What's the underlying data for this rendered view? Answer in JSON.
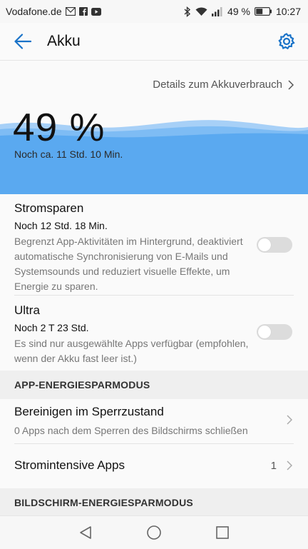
{
  "status_bar": {
    "carrier": "Vodafone.de",
    "icons_left": [
      "mail-icon",
      "facebook-icon",
      "youtube-icon"
    ],
    "icons_right": [
      "bluetooth-icon",
      "wifi-icon",
      "signal-icon",
      "battery-icon"
    ],
    "battery_percent": "49 %",
    "time": "10:27"
  },
  "header": {
    "title": "Akku"
  },
  "hero": {
    "details_link": "Details zum Akkuverbrauch",
    "percent": "49 %",
    "remaining": "Noch ca. 11 Std. 10 Min.",
    "wave_color": "#5aa9f0"
  },
  "power_saving": {
    "title": "Stromsparen",
    "subtitle": "Noch 12 Std. 18 Min.",
    "description": "Begrenzt App-Aktivitäten im Hintergrund, deaktiviert automatische Synchronisierung von E-Mails und Systemsounds und reduziert visuelle Effekte, um Energie zu sparen.",
    "enabled": false
  },
  "ultra": {
    "title": "Ultra",
    "subtitle": "Noch 2 T 23 Std.",
    "description": "Es sind nur ausgewählte Apps verfügbar (empfohlen, wenn der Akku fast leer ist.)",
    "enabled": false
  },
  "app_section": {
    "header": "APP-ENERGIESPARMODUS",
    "items": [
      {
        "title": "Bereinigen im Sperrzustand",
        "subtitle": "0 Apps nach dem Sperren des Bildschirms schließen"
      },
      {
        "title": "Stromintensive Apps",
        "count": "1"
      }
    ]
  },
  "screen_section": {
    "header": "BILDSCHIRM-ENERGIESPARMODUS"
  },
  "accent_color": "#1a73c8"
}
